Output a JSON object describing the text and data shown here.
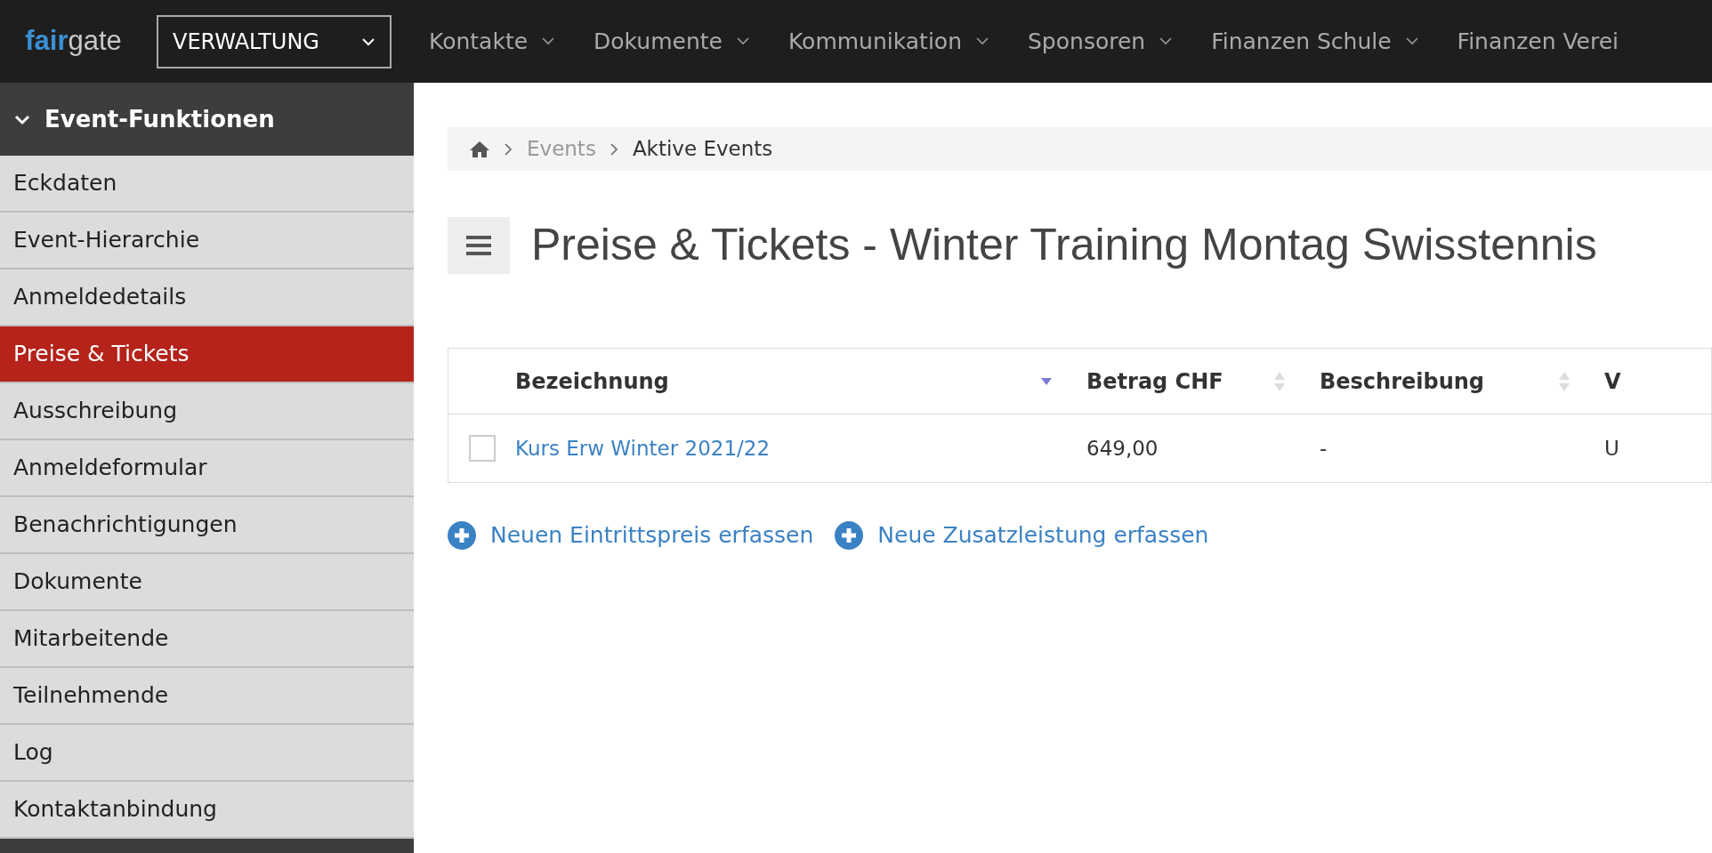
{
  "logo": {
    "part_1": "fair",
    "part_2": "gate"
  },
  "module_select": {
    "value": "VERWALTUNG"
  },
  "nav": [
    {
      "label": "Kontakte",
      "dropdown": true
    },
    {
      "label": "Dokumente",
      "dropdown": true
    },
    {
      "label": "Kommunikation",
      "dropdown": true
    },
    {
      "label": "Sponsoren",
      "dropdown": true
    },
    {
      "label": "Finanzen Schule",
      "dropdown": true
    },
    {
      "label": "Finanzen Verei",
      "dropdown": false
    }
  ],
  "sidebar": {
    "title": "Event-Funktionen",
    "expanded": true,
    "items": [
      {
        "label": "Eckdaten",
        "selected": false
      },
      {
        "label": "Event-Hierarchie",
        "selected": false
      },
      {
        "label": "Anmeldedetails",
        "selected": false
      },
      {
        "label": "Preise & Tickets",
        "selected": true
      },
      {
        "label": "Ausschreibung",
        "selected": false
      },
      {
        "label": "Anmeldeformular",
        "selected": false
      },
      {
        "label": "Benachrichtigungen",
        "selected": false
      },
      {
        "label": "Dokumente",
        "selected": false
      },
      {
        "label": "Mitarbeitende",
        "selected": false
      },
      {
        "label": "Teilnehmende",
        "selected": false
      },
      {
        "label": "Log",
        "selected": false
      },
      {
        "label": "Kontaktanbindung",
        "selected": false
      }
    ]
  },
  "breadcrumb": [
    {
      "label": "Events",
      "kind": "link"
    },
    {
      "label": "Aktive Events",
      "kind": "current"
    }
  ],
  "page_title": "Preise & Tickets - Winter Training Montag Swisstennis",
  "table": {
    "columns": [
      {
        "label": "Bezeichnung",
        "sorted": true
      },
      {
        "label": "Betrag CHF",
        "sorted": false
      },
      {
        "label": "Beschreibung",
        "sorted": false
      },
      {
        "label": "V"
      }
    ],
    "rows": [
      {
        "checked": false,
        "cells": [
          "Kurs Erw Winter 2021/22",
          "649,00",
          "-",
          "U"
        ]
      }
    ]
  },
  "actions": [
    "Neuen Eintrittspreis erfassen",
    "Neue Zusatzleistung erfassen"
  ]
}
